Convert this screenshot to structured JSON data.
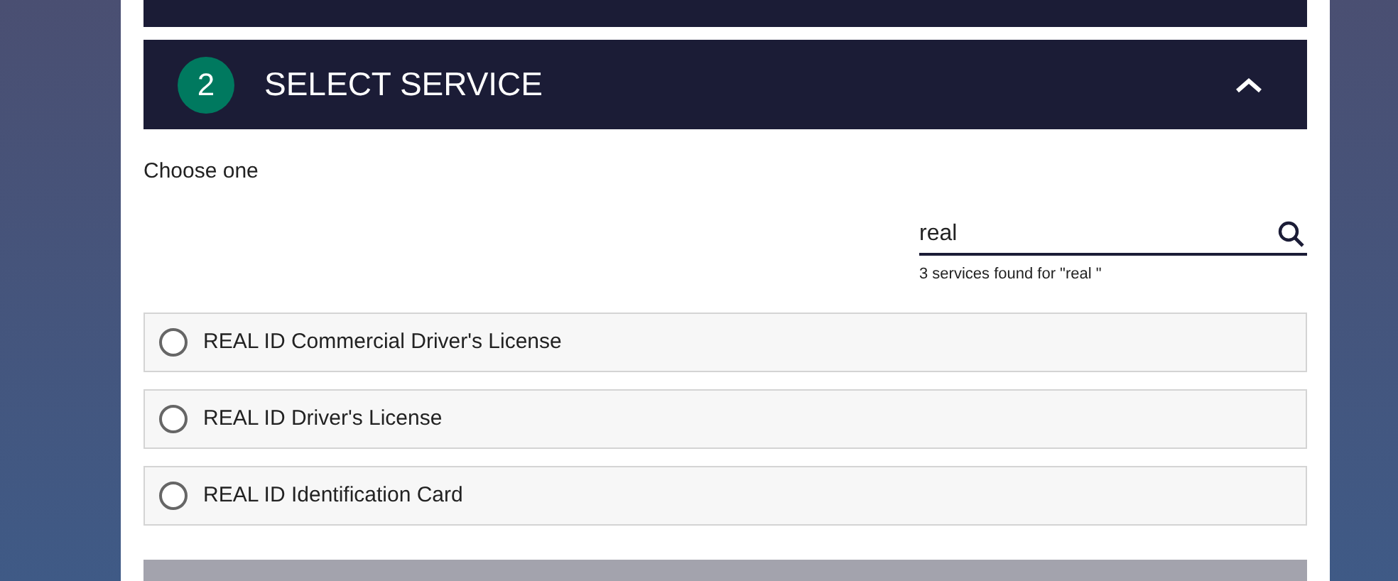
{
  "step": {
    "number": "2",
    "title": "SELECT SERVICE",
    "expanded": true
  },
  "prompt": "Choose one",
  "search": {
    "value": "real",
    "result_note": "3 services found for \"real \""
  },
  "services": [
    {
      "label": "REAL ID Commercial Driver's License",
      "selected": false
    },
    {
      "label": "REAL ID Driver's License",
      "selected": false
    },
    {
      "label": "REAL ID Identification Card",
      "selected": false
    }
  ]
}
